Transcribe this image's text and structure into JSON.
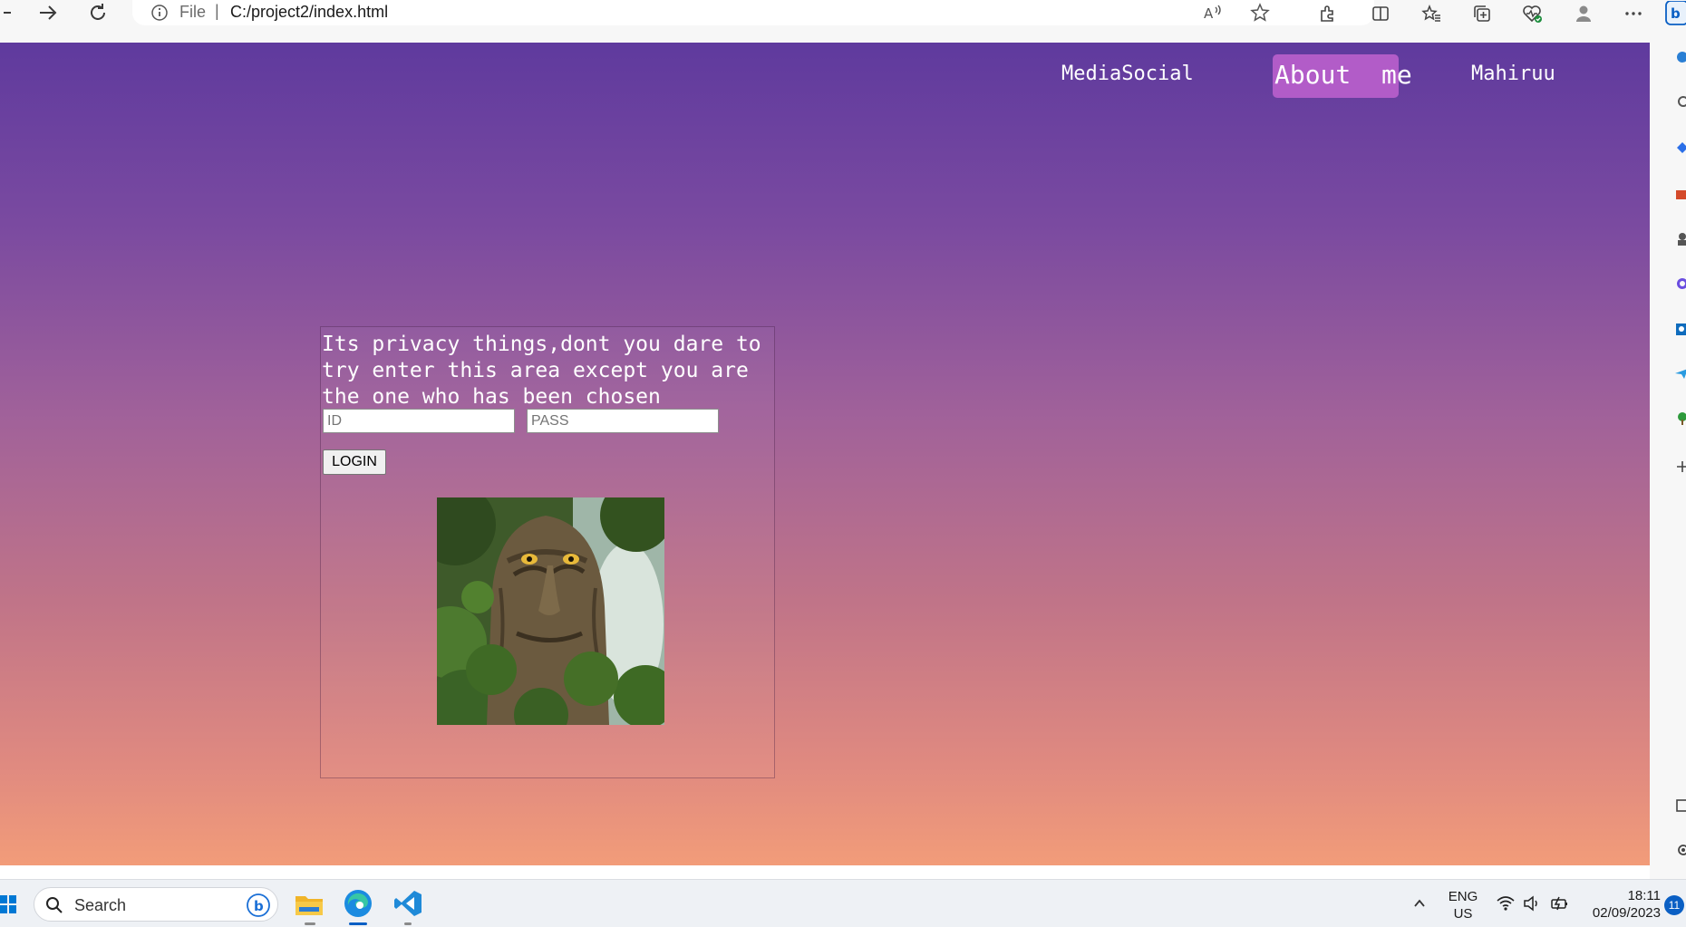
{
  "browser": {
    "scheme_label": "File",
    "separator": "|",
    "url": "C:/project2/index.html"
  },
  "page": {
    "nav": [
      "MediaSocial",
      "About  me",
      "Mahiruu"
    ],
    "panel_message": "Its privacy things,dont you dare to try enter this area except you are the one who has been chosen",
    "id_placeholder": "ID",
    "pass_placeholder": "PASS",
    "login_label": "LOGIN"
  },
  "taskbar": {
    "search_label": "Search",
    "lang_line1": "ENG",
    "lang_line2": "US",
    "time": "18:11",
    "date": "02/09/2023",
    "notification_count": "11"
  },
  "colors": {
    "gradient_top": "#5f3a9e",
    "gradient_bottom": "#f29c79",
    "nav_active_bg": "#b25cc8"
  }
}
